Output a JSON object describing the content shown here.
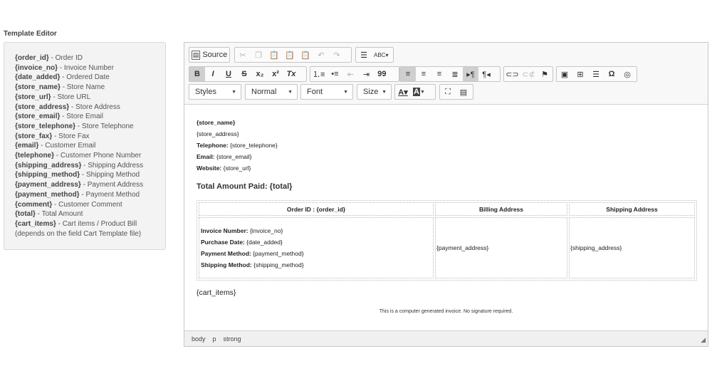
{
  "page_title": "Template Editor",
  "variables": [
    {
      "tag": "{order_id}",
      "desc": " - Order ID"
    },
    {
      "tag": "{invoice_no}",
      "desc": " - Invoice Number"
    },
    {
      "tag": "{date_added}",
      "desc": " - Ordered Date"
    },
    {
      "tag": "{store_name}",
      "desc": " - Store Name"
    },
    {
      "tag": "{store_url}",
      "desc": " - Store URL"
    },
    {
      "tag": "{store_address}",
      "desc": " - Store Address"
    },
    {
      "tag": "{store_email}",
      "desc": " - Store Email"
    },
    {
      "tag": "{store_telephone}",
      "desc": " - Store Telephone"
    },
    {
      "tag": "{store_fax}",
      "desc": " - Store Fax"
    },
    {
      "tag": "{email}",
      "desc": " - Customer Email"
    },
    {
      "tag": "{telephone}",
      "desc": " - Customer Phone Number"
    },
    {
      "tag": "{shipping_address}",
      "desc": " - Shipping Address"
    },
    {
      "tag": "{shipping_method}",
      "desc": " - Shipping Method"
    },
    {
      "tag": "{payment_address}",
      "desc": " - Payment Address"
    },
    {
      "tag": "{payment_method}",
      "desc": " - Payment Method"
    },
    {
      "tag": "{comment}",
      "desc": " - Customer Comment"
    },
    {
      "tag": "{total}",
      "desc": " - Total Amount"
    },
    {
      "tag": "{cart_items}",
      "desc": " - Cart items / Product Bill"
    },
    {
      "tag": "",
      "desc": "(depends on the field Cart Template file)"
    }
  ],
  "toolbar": {
    "source_label": "Source",
    "styles_label": "Styles",
    "format_label": "Normal",
    "font_label": "Font",
    "size_label": "Size",
    "bold": "B",
    "italic": "I",
    "underline": "U",
    "strike": "S",
    "subscript": "x₂",
    "superscript": "x²",
    "remove_format": "Tx",
    "quote": "99",
    "special_char": "Ω"
  },
  "content": {
    "store_name": "{store_name}",
    "store_address": "{store_address}",
    "telephone_label": "Telephone:",
    "telephone_value": " {store_telephone}",
    "email_label": "Email:",
    "email_value": " {store_email}",
    "website_label": "Website:",
    "website_value": " {store_url}",
    "total_heading": "Total Amount Paid: {total}",
    "table": {
      "col1_header": "Order ID : {order_id}",
      "col2_header": "Billing Address",
      "col3_header": "Shipping Address",
      "invoice_label": "Invoice Number:",
      "invoice_value": " {invoice_no}",
      "purchase_label": "Purchase Date:",
      "purchase_value": " {date_added}",
      "payment_label": "Payment Method:",
      "payment_value": " {payment_method}",
      "shipping_label": "Shipping Method:",
      "shipping_value": " {shipping_method}",
      "billing_value": "{payment_address}",
      "shipping_address_value": "{shipping_address}"
    },
    "cart_items": "{cart_items}",
    "footer_note": "This is a computer generated invoice. No signature required."
  },
  "statusbar": [
    "body",
    "p",
    "strong"
  ]
}
